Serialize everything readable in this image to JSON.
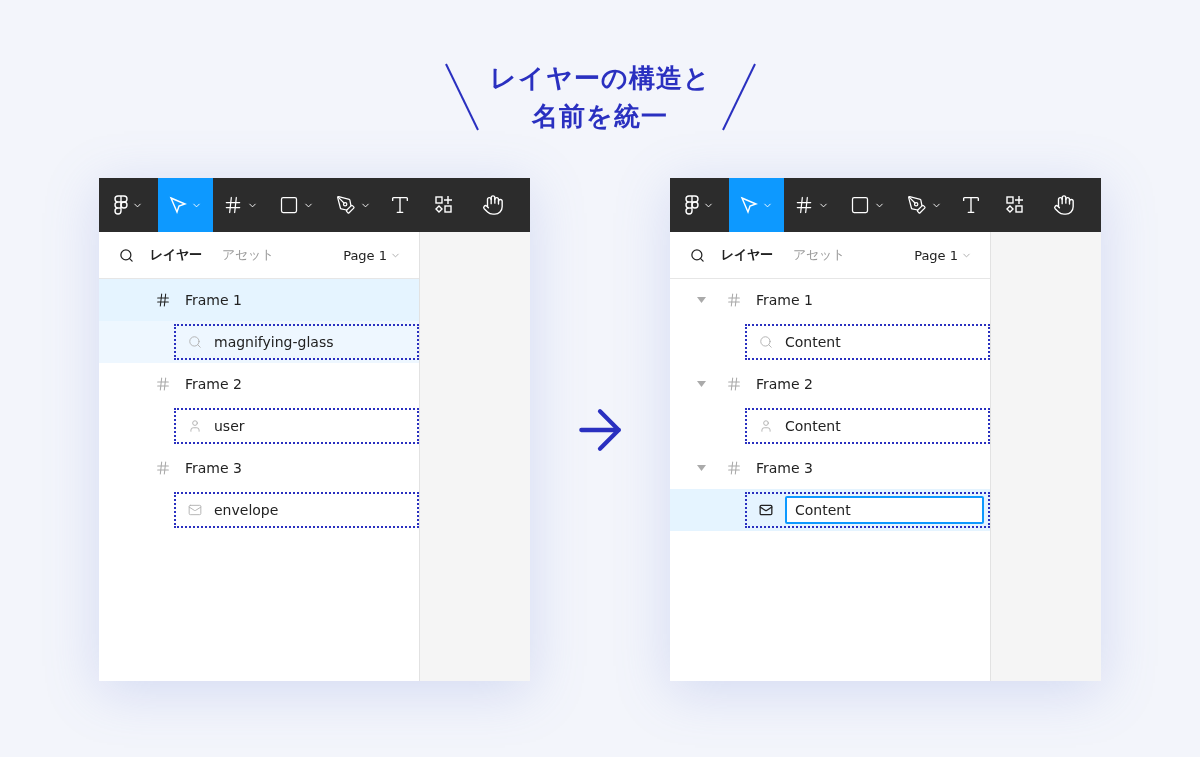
{
  "heading": {
    "lines": [
      "レイヤーの構造と",
      "名前を統一"
    ]
  },
  "panels": [
    {
      "toolbar": [
        {
          "kind": "logo",
          "selected": false,
          "dropdown": true
        },
        {
          "kind": "move",
          "selected": true,
          "dropdown": true
        },
        {
          "kind": "frame",
          "selected": false,
          "dropdown": true
        },
        {
          "kind": "shape",
          "selected": false,
          "dropdown": true
        },
        {
          "kind": "pen",
          "selected": false,
          "dropdown": true
        },
        {
          "kind": "text",
          "selected": false,
          "dropdown": false
        },
        {
          "kind": "components",
          "selected": false,
          "dropdown": false
        },
        {
          "kind": "hand",
          "selected": false,
          "dropdown": false
        }
      ],
      "tabs": [
        {
          "label": "レイヤー",
          "selected": true
        },
        {
          "label": "アセット",
          "selected": false
        }
      ],
      "page": "Page 1",
      "layers": [
        {
          "name": "Frame 1",
          "selected": true,
          "children": [
            {
              "name": "magnifying-glass",
              "kind": "search",
              "selected": false,
              "editing": false
            }
          ]
        },
        {
          "name": "Frame 2",
          "selected": false,
          "children": [
            {
              "name": "user",
              "kind": "user",
              "selected": false,
              "editing": false
            }
          ]
        },
        {
          "name": "Frame 3",
          "selected": false,
          "children": [
            {
              "name": "envelope",
              "kind": "mail",
              "selected": false,
              "editing": false
            }
          ]
        }
      ]
    },
    {
      "toolbar": [
        {
          "kind": "logo",
          "selected": false,
          "dropdown": true
        },
        {
          "kind": "move",
          "selected": true,
          "dropdown": true
        },
        {
          "kind": "frame",
          "selected": false,
          "dropdown": true
        },
        {
          "kind": "shape",
          "selected": false,
          "dropdown": true
        },
        {
          "kind": "pen",
          "selected": false,
          "dropdown": true
        },
        {
          "kind": "text",
          "selected": false,
          "dropdown": false
        },
        {
          "kind": "components",
          "selected": false,
          "dropdown": false
        },
        {
          "kind": "hand",
          "selected": false,
          "dropdown": false
        }
      ],
      "tabs": [
        {
          "label": "レイヤー",
          "selected": true
        },
        {
          "label": "アセット",
          "selected": false
        }
      ],
      "page": "Page 1",
      "layers": [
        {
          "name": "Frame 1",
          "selected": false,
          "expanded": true,
          "children": [
            {
              "name": "Content",
              "kind": "search",
              "selected": false,
              "editing": false
            }
          ]
        },
        {
          "name": "Frame 2",
          "selected": false,
          "expanded": true,
          "children": [
            {
              "name": "Content",
              "kind": "user",
              "selected": false,
              "editing": false
            }
          ]
        },
        {
          "name": "Frame 3",
          "selected": false,
          "expanded": true,
          "children": [
            {
              "name": "Content",
              "kind": "mail",
              "selected": true,
              "editing": true
            }
          ]
        }
      ]
    }
  ]
}
